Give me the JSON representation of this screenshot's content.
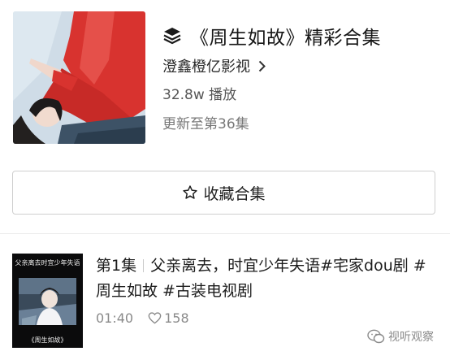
{
  "collection": {
    "cover_image": "drama-cover-red-robe",
    "title": "《周生如故》精彩合集",
    "author": "澄鑫橙亿影视",
    "plays": "32.8w 播放",
    "updated": "更新至第36集"
  },
  "favorite_button": {
    "label": "收藏合集"
  },
  "episode": {
    "label": "第1集",
    "title": "父亲离去，时宜少年失语#宅家dou剧 #周生如故 #古装电视剧",
    "duration": "01:40",
    "likes": "158",
    "thumbnail_caption_top": "父亲离去时宜少年失语",
    "thumbnail_caption_bottom": "《周生如故》"
  },
  "watermark": {
    "text": "视听观察"
  },
  "colors": {
    "accent_red": "#d93a35",
    "text_dark": "#1a1a1a",
    "text_gray": "#777777"
  }
}
